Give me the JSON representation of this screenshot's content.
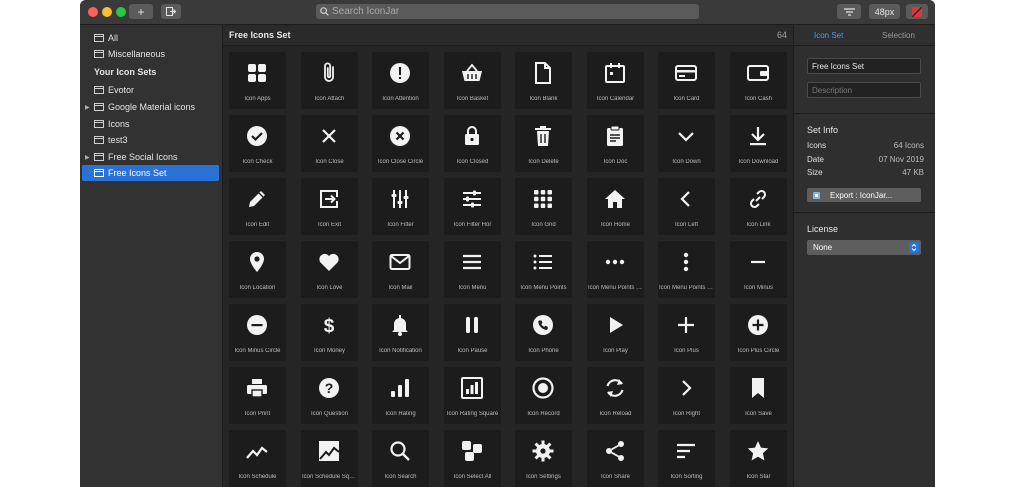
{
  "toolbar": {
    "add_label": "+",
    "search_placeholder": "Search IconJar",
    "size_label": "48px",
    "icons": {
      "add": "plus-icon",
      "export": "export-icon",
      "search": "search-icon",
      "filter": "filter-icon",
      "color": "color-swatch-icon"
    }
  },
  "sidebar": {
    "items": [
      {
        "label": "All"
      },
      {
        "label": "Miscellaneous"
      }
    ],
    "section_title": "Your Icon Sets",
    "sets": [
      {
        "label": "Evotor",
        "expandable": false,
        "selected": false
      },
      {
        "label": "Google Material icons",
        "expandable": true,
        "selected": false
      },
      {
        "label": "Icons",
        "expandable": false,
        "selected": false
      },
      {
        "label": "test3",
        "expandable": false,
        "selected": false
      },
      {
        "label": "Free Social Icons",
        "expandable": true,
        "selected": false
      },
      {
        "label": "Free Icons Set",
        "expandable": false,
        "selected": true
      }
    ]
  },
  "main": {
    "title": "Free Icons Set",
    "count": "64",
    "icons": [
      {
        "label": "Icon Apps",
        "icon": "apps"
      },
      {
        "label": "Icon Attach",
        "icon": "attach"
      },
      {
        "label": "Icon Attention",
        "icon": "attention"
      },
      {
        "label": "Icon Basket",
        "icon": "basket"
      },
      {
        "label": "Icon Blank",
        "icon": "blank"
      },
      {
        "label": "Icon Calendar",
        "icon": "calendar"
      },
      {
        "label": "Icon Card",
        "icon": "card"
      },
      {
        "label": "Icon Cash",
        "icon": "cash"
      },
      {
        "label": "Icon Check",
        "icon": "check"
      },
      {
        "label": "Icon Close",
        "icon": "close"
      },
      {
        "label": "Icon Close Circle",
        "icon": "close-circle"
      },
      {
        "label": "Icon Closed",
        "icon": "closed"
      },
      {
        "label": "Icon Delete",
        "icon": "delete"
      },
      {
        "label": "Icon Doc",
        "icon": "doc"
      },
      {
        "label": "Icon Down",
        "icon": "down"
      },
      {
        "label": "Icon Download",
        "icon": "download"
      },
      {
        "label": "Icon Edit",
        "icon": "edit"
      },
      {
        "label": "Icon Exit",
        "icon": "exit"
      },
      {
        "label": "Icon Filter",
        "icon": "filter"
      },
      {
        "label": "Icon Filter Hor",
        "icon": "filter-hor"
      },
      {
        "label": "Icon Grid",
        "icon": "grid"
      },
      {
        "label": "Icon Home",
        "icon": "home"
      },
      {
        "label": "Icon Left",
        "icon": "left"
      },
      {
        "label": "Icon Link",
        "icon": "link"
      },
      {
        "label": "Icon Location",
        "icon": "location"
      },
      {
        "label": "Icon Love",
        "icon": "love"
      },
      {
        "label": "Icon Mail",
        "icon": "mail"
      },
      {
        "label": "Icon Menu",
        "icon": "menu"
      },
      {
        "label": "Icon Menu Points",
        "icon": "menu-points"
      },
      {
        "label": "Icon Menu Points Hor",
        "icon": "menu-points-hor"
      },
      {
        "label": "Icon Menu Points Ver",
        "icon": "menu-points-ver"
      },
      {
        "label": "Icon Minus",
        "icon": "minus"
      },
      {
        "label": "Icon Minus Circle",
        "icon": "minus-circle"
      },
      {
        "label": "Icon Money",
        "icon": "money"
      },
      {
        "label": "Icon Notification",
        "icon": "notification"
      },
      {
        "label": "Icon Pause",
        "icon": "pause"
      },
      {
        "label": "Icon Phone",
        "icon": "phone"
      },
      {
        "label": "Icon Play",
        "icon": "play"
      },
      {
        "label": "Icon Plus",
        "icon": "plus"
      },
      {
        "label": "Icon Plus Circle",
        "icon": "plus-circle"
      },
      {
        "label": "Icon Print",
        "icon": "print"
      },
      {
        "label": "Icon Question",
        "icon": "question"
      },
      {
        "label": "Icon Rating",
        "icon": "rating"
      },
      {
        "label": "Icon Rating Square",
        "icon": "rating-square"
      },
      {
        "label": "Icon Record",
        "icon": "record"
      },
      {
        "label": "Icon Reload",
        "icon": "reload"
      },
      {
        "label": "Icon Right",
        "icon": "right"
      },
      {
        "label": "Icon Save",
        "icon": "save"
      },
      {
        "label": "Icon Schedule",
        "icon": "schedule"
      },
      {
        "label": "Icon Schedule Square",
        "icon": "schedule-square"
      },
      {
        "label": "Icon Search",
        "icon": "search"
      },
      {
        "label": "Icon Select All",
        "icon": "select-all"
      },
      {
        "label": "Icon Settings",
        "icon": "settings"
      },
      {
        "label": "Icon Share",
        "icon": "share"
      },
      {
        "label": "Icon Sorting",
        "icon": "sorting"
      },
      {
        "label": "Icon Star",
        "icon": "star"
      }
    ]
  },
  "inspector": {
    "tabs": [
      "Icon Set",
      "Selection"
    ],
    "name_value": "Free Icons Set",
    "description_placeholder": "Description",
    "set_info_title": "Set Info",
    "info": [
      {
        "key": "Icons",
        "value": "64 Icons"
      },
      {
        "key": "Date",
        "value": "07 Nov 2019"
      },
      {
        "key": "Size",
        "value": "47 KB"
      }
    ],
    "export_label": "Export : IconJar...",
    "license_title": "License",
    "license_value": "None"
  },
  "colors": {
    "accent": "#2a72d6",
    "tab_active": "#4d9bf5"
  }
}
